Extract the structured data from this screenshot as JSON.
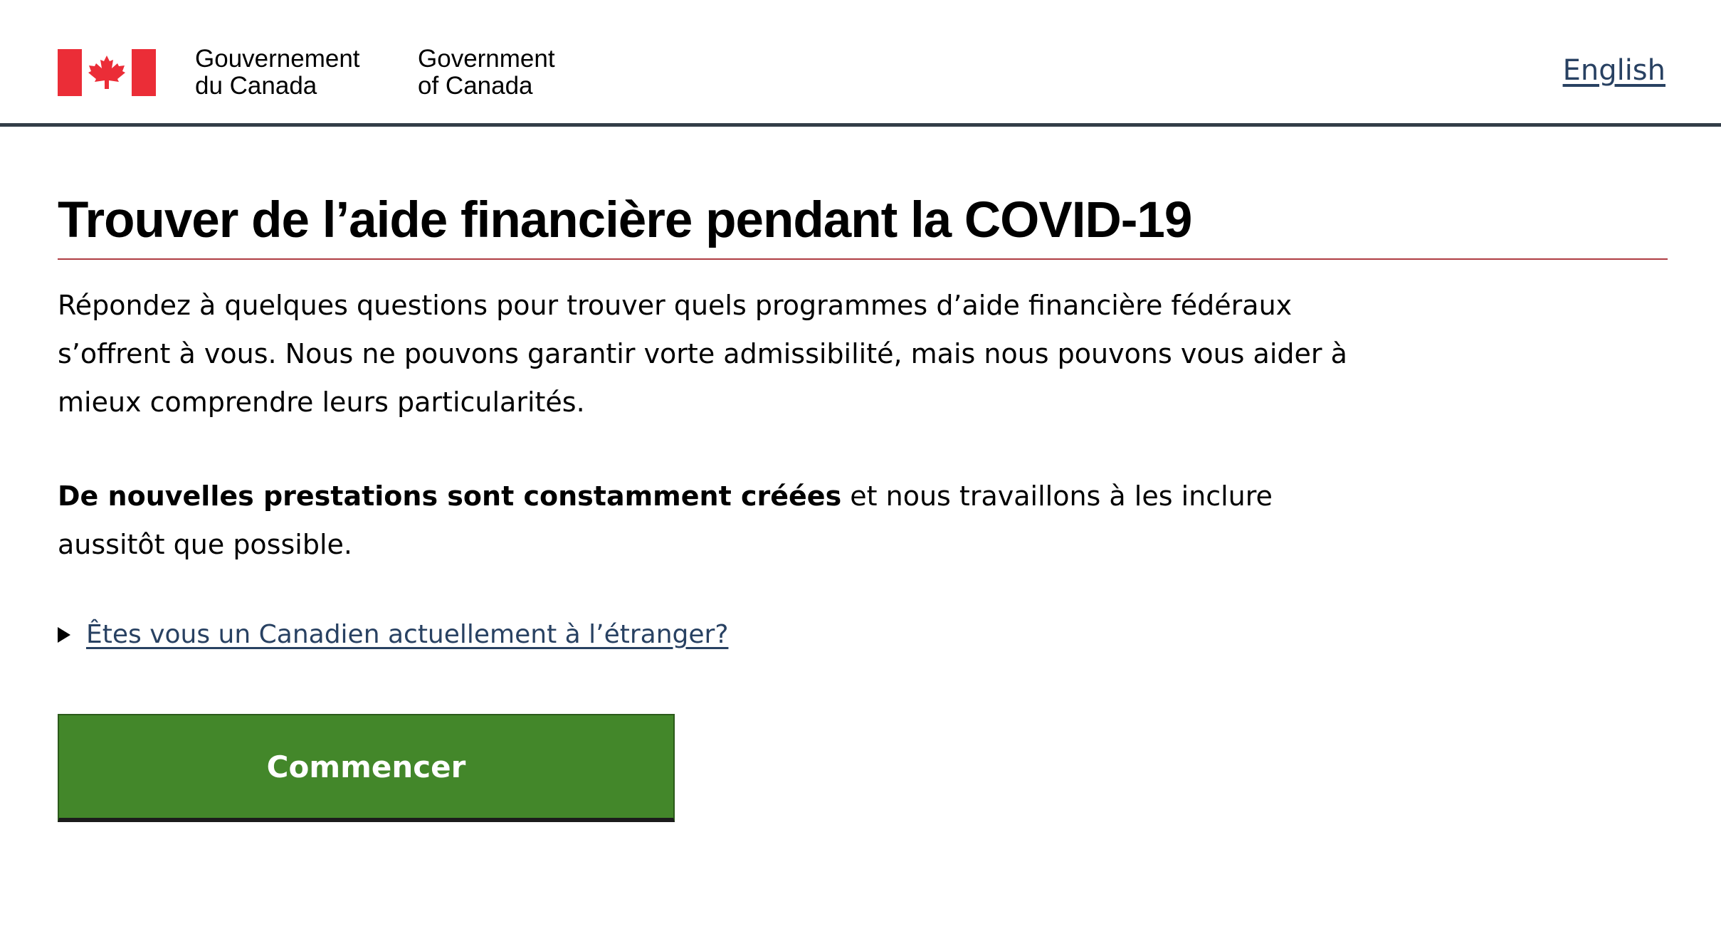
{
  "header": {
    "wordmark_fr_line1": "Gouvernement",
    "wordmark_fr_line2": "du Canada",
    "wordmark_en_line1": "Government",
    "wordmark_en_line2": "of Canada",
    "language_link": "English",
    "flag_icon": "canada-flag-icon",
    "flag_color": "#eb2d37",
    "rule_color": "#333e48"
  },
  "main": {
    "title": "Trouver de l’aide financière pendant la COVID-19",
    "intro": "Répondez à quelques questions pour trouver quels programmes d’aide financière fédéraux s’offrent à vous. Nous ne pouvons garantir vorte admissibilité, mais nous pouvons vous aider à mieux comprendre leurs particularités.",
    "notice_bold": "De nouvelles prestations sont constamment créées",
    "notice_rest": " et nous travaillons à les inclure aussitôt que possible.",
    "details_summary": "Êtes vous un Canadien actuellement à l’étranger?",
    "details_icon": "triangle-right-icon",
    "start_button": "Commencer",
    "title_rule_color": "#af3c43",
    "button_color": "#43872a",
    "link_color": "#284162"
  }
}
